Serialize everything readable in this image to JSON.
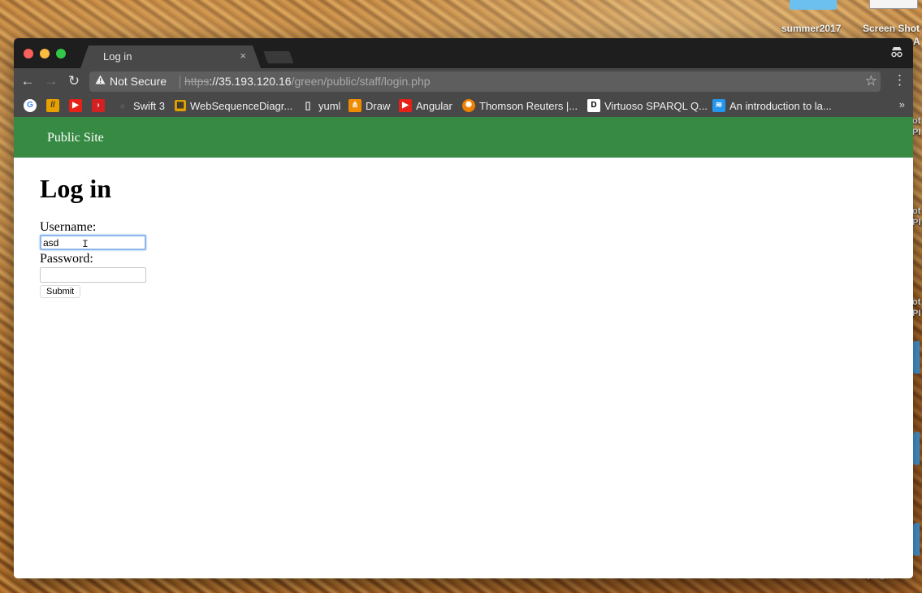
{
  "desktop": {
    "icons": [
      {
        "label": "summer2017"
      },
      {
        "label": "Screen Shot"
      },
      {
        "label": "A"
      }
    ],
    "edge_fragments": [
      "ot",
      "PI",
      "ot",
      "PI",
      "ot",
      "PI"
    ],
    "bottom_fragment": "p . g . 17"
  },
  "browser": {
    "tab": {
      "title": "Log in",
      "close": "×"
    },
    "incognito_icon": "incognito-icon",
    "nav": {
      "back": "←",
      "forward": "→",
      "reload": "↻"
    },
    "address": {
      "security_icon": "warning-triangle-icon",
      "security_label": "Not Secure",
      "scheme": "https",
      "host": "://35.193.120.16",
      "path": "/green/public/staff/login.php"
    },
    "star": "☆",
    "menu": "⋮",
    "bookmarks": [
      {
        "label": "",
        "icon": "google-icon",
        "color": "#ffffff"
      },
      {
        "label": "",
        "icon": "slashes-icon",
        "color": "#e8a000"
      },
      {
        "label": "",
        "icon": "youtube-icon",
        "color": "#e62117"
      },
      {
        "label": "",
        "icon": "chevron-red-icon",
        "color": "#d32020"
      },
      {
        "label": "Swift 3",
        "icon": "dot-icon",
        "color": "#555555"
      },
      {
        "label": "WebSequenceDiagr...",
        "icon": "wsd-icon",
        "color": "#e0a000"
      },
      {
        "label": "yuml",
        "icon": "page-icon",
        "color": "#dddddd"
      },
      {
        "label": "Draw",
        "icon": "draw-icon",
        "color": "#f08c00"
      },
      {
        "label": "Angular",
        "icon": "youtube-icon",
        "color": "#e62117"
      },
      {
        "label": "Thomson Reuters |...",
        "icon": "thomson-icon",
        "color": "#f08000"
      },
      {
        "label": "Virtuoso SPARQL Q...",
        "icon": "d-icon",
        "color": "#ffffff"
      },
      {
        "label": "An introduction to la...",
        "icon": "docker-icon",
        "color": "#2496ed"
      }
    ],
    "bookmarks_more": "»"
  },
  "page": {
    "header_link": "Public Site",
    "header_color": "#368a43",
    "heading": "Log in",
    "username_label": "Username:",
    "username_value": "asd",
    "password_label": "Password:",
    "password_value": "",
    "submit_label": "Submit"
  }
}
